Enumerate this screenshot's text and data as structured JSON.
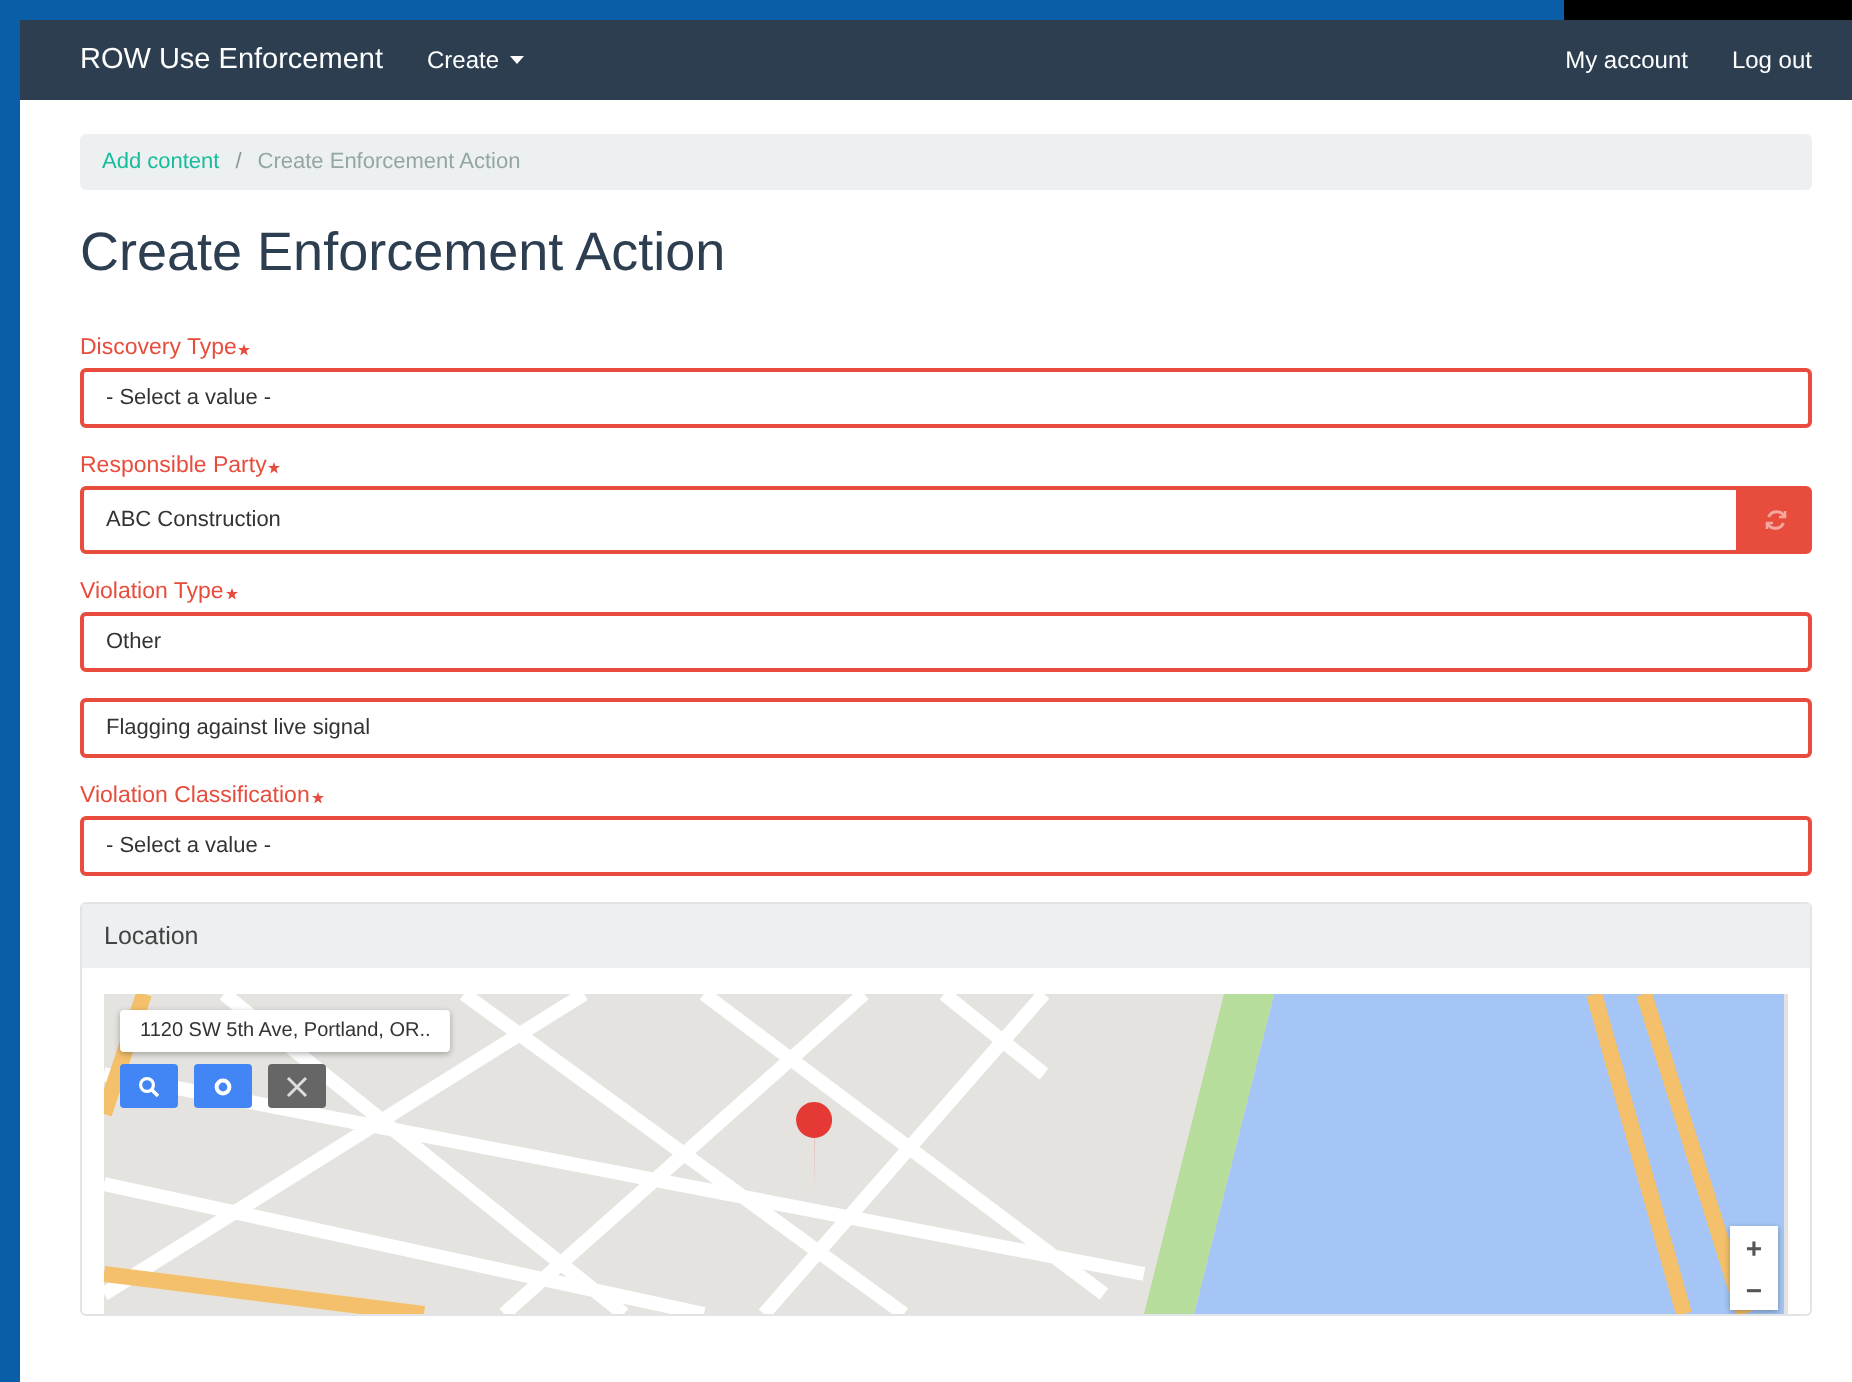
{
  "navbar": {
    "brand": "ROW Use Enforcement",
    "menu": [
      {
        "label": "Create",
        "dropdown": true
      }
    ],
    "right_links": [
      "My account",
      "Log out"
    ]
  },
  "breadcrumb_separator": "/",
  "breadcrumb": [
    {
      "label": "Add content",
      "link": true
    },
    {
      "label": "Create Enforcement Action",
      "link": false
    }
  ],
  "title": "Create Enforcement Action",
  "fields": [
    {
      "kind": "select",
      "label": "Discovery Type",
      "required": true,
      "value": "- Select a value -"
    },
    {
      "kind": "autocomplete",
      "label": "Responsible Party",
      "required": true,
      "value": "ABC Construction"
    },
    {
      "kind": "select",
      "label": "Violation Type",
      "required": true,
      "value": "Other"
    },
    {
      "kind": "text",
      "value": "Flagging against live signal"
    },
    {
      "kind": "select",
      "label": "Violation Classification",
      "required": true,
      "value": "- Select a value -"
    }
  ],
  "location": {
    "heading": "Location",
    "address": "1120 SW 5th Ave, Portland, OR..",
    "zoom_in": "+",
    "zoom_out": "−"
  }
}
